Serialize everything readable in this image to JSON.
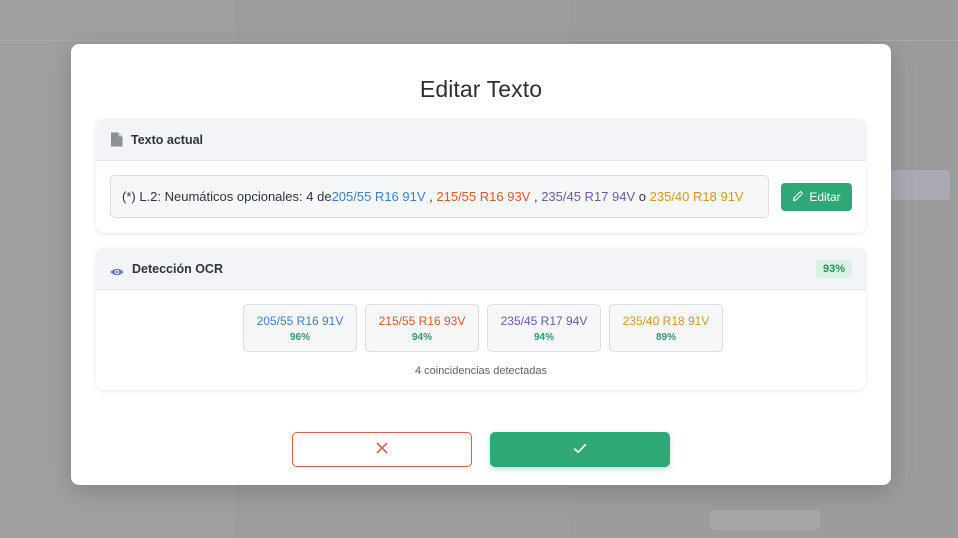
{
  "modal": {
    "title": "Editar Texto"
  },
  "current_text": {
    "header": "Texto actual",
    "prefix": "(*) L.2: Neumáticos opcionales: 4 de ",
    "tire1": "205/55 R16 91V",
    "sep1": " , ",
    "tire2": "215/55 R16 93V",
    "sep2": " , ",
    "tire3": "235/45 R17 94V",
    "sep3": " o ",
    "tire4": "235/40 R18 91V",
    "edit_label": "Editar"
  },
  "ocr": {
    "header": "Detección OCR",
    "confidence": "93%",
    "matches": [
      {
        "label": "205/55 R16 91V",
        "pct": "96%",
        "color": "#3b7fd0"
      },
      {
        "label": "215/55 R16 93V",
        "pct": "94%",
        "color": "#e05a26"
      },
      {
        "label": "235/45 R17 94V",
        "pct": "94%",
        "color": "#6a5aa8"
      },
      {
        "label": "235/40 R18 91V",
        "pct": "89%",
        "color": "#d49a1c"
      }
    ],
    "count_text": "4 coincidencias detectadas"
  },
  "icons": {
    "document": "document-icon",
    "eye": "eye-icon",
    "pencil": "pencil-icon",
    "close": "close-icon",
    "check": "check-icon"
  },
  "colors": {
    "accent_green": "#2ea876",
    "danger_red": "#e45b4b"
  }
}
